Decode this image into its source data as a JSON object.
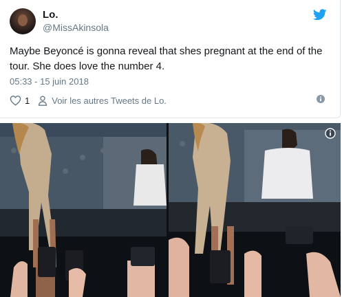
{
  "tweet": {
    "display_name": "Lo.",
    "handle": "@MissAkinsola",
    "text": "Maybe Beyoncé is gonna reveal that shes pregnant at the end of the tour. She does love the number 4.",
    "timestamp": "05:33 - 15 juin 2018",
    "like_count": "1",
    "more_tweets_label": "Voir les autres Tweets de Lo."
  },
  "icons": {
    "platform": "twitter-bird-icon",
    "like": "heart-icon",
    "profile": "person-icon",
    "info": "info-icon",
    "media_info": "info-icon"
  },
  "colors": {
    "brand": "#1da1f2",
    "secondary_text": "#657786",
    "primary_text": "#14171a",
    "border": "#e1e8ed"
  }
}
